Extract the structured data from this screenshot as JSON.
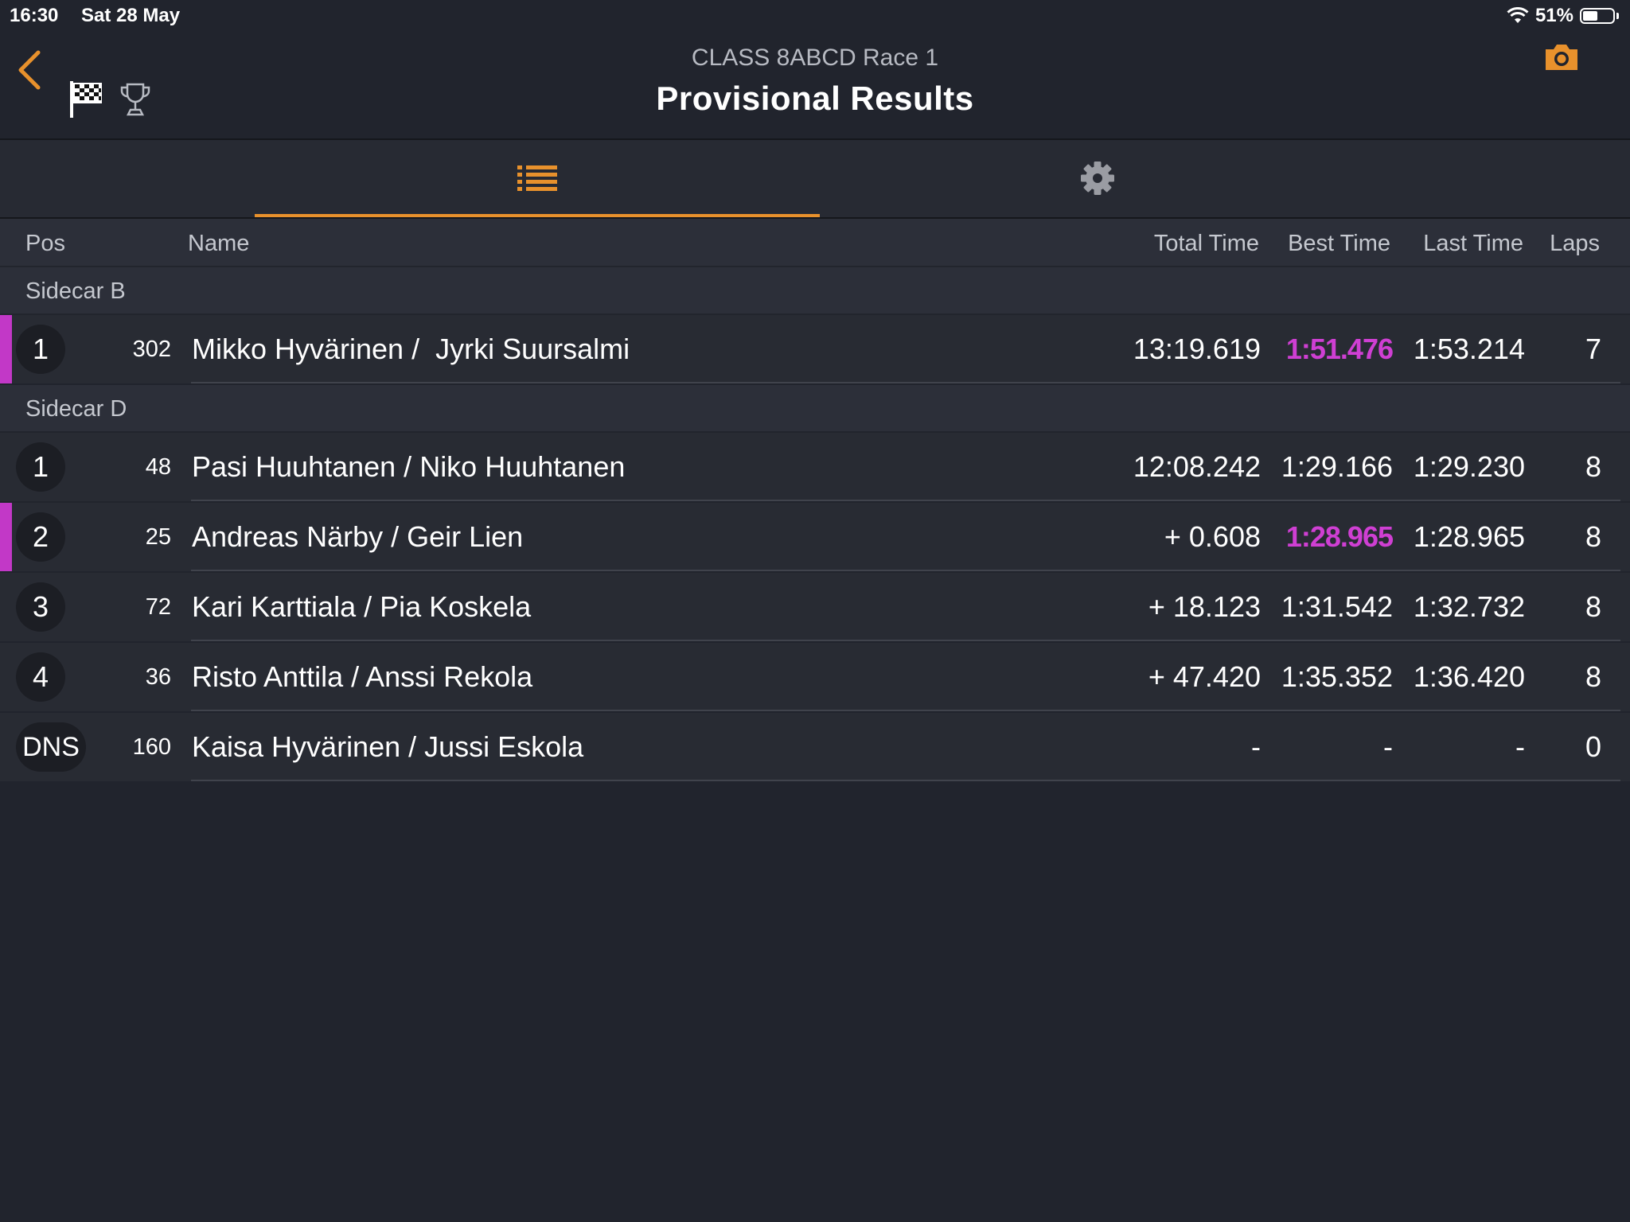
{
  "status": {
    "time": "16:30",
    "date": "Sat 28 May",
    "battery": "51%",
    "battery_level": 0.51
  },
  "header": {
    "subtitle": "CLASS 8ABCD Race 1",
    "title": "Provisional Results"
  },
  "colors": {
    "accent": "#e8912c",
    "best_highlight": "#cf3fd3",
    "background": "#21242d"
  },
  "icons": {
    "back": "chevron-left",
    "flag": "checkered-flag",
    "trophy": "trophy",
    "camera": "camera",
    "list_tab": "list",
    "settings_tab": "gear"
  },
  "columns": {
    "pos": "Pos",
    "name": "Name",
    "total": "Total Time",
    "best": "Best Time",
    "last": "Last Time",
    "laps": "Laps"
  },
  "groups": [
    {
      "label": "Sidecar B",
      "rows": [
        {
          "pos": "1",
          "num": "302",
          "name": "Mikko Hyvärinen /  Jyrki Suursalmi",
          "total": "13:19.619",
          "best": "1:51.476",
          "best_highlight": true,
          "last": "1:53.214",
          "laps": "7",
          "marked": true
        }
      ]
    },
    {
      "label": "Sidecar D",
      "rows": [
        {
          "pos": "1",
          "num": "48",
          "name": "Pasi Huuhtanen / Niko Huuhtanen",
          "total": "12:08.242",
          "best": "1:29.166",
          "best_highlight": false,
          "last": "1:29.230",
          "laps": "8",
          "marked": false
        },
        {
          "pos": "2",
          "num": "25",
          "name": "Andreas Närby / Geir Lien",
          "total": "+ 0.608",
          "best": "1:28.965",
          "best_highlight": true,
          "last": "1:28.965",
          "laps": "8",
          "marked": true
        },
        {
          "pos": "3",
          "num": "72",
          "name": "Kari Karttiala / Pia Koskela",
          "total": "+ 18.123",
          "best": "1:31.542",
          "best_highlight": false,
          "last": "1:32.732",
          "laps": "8",
          "marked": false
        },
        {
          "pos": "4",
          "num": "36",
          "name": "Risto Anttila / Anssi Rekola",
          "total": "+ 47.420",
          "best": "1:35.352",
          "best_highlight": false,
          "last": "1:36.420",
          "laps": "8",
          "marked": false
        },
        {
          "pos": "DNS",
          "num": "160",
          "name": "Kaisa Hyvärinen / Jussi Eskola",
          "total": "-",
          "best": "-",
          "best_highlight": false,
          "last": "-",
          "laps": "0",
          "marked": false
        }
      ]
    }
  ]
}
